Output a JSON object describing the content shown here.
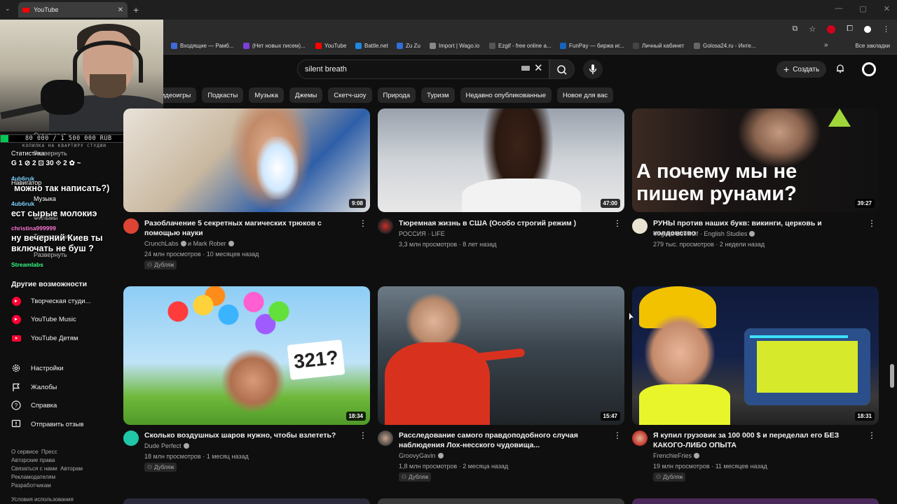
{
  "browser": {
    "tab_title": "YouTube",
    "bookmarks": [
      "Входящие — Рамб...",
      "(Нет новых писем)...",
      "YouTube",
      "Battle.net",
      "Zu Zu",
      "Import | Wago.io",
      "Ezgif - free online a...",
      "FunPay — биржа иг...",
      "Личный кабинет",
      "Golosa24.ru - Инте..."
    ],
    "all_bookmarks": "Все закладки"
  },
  "header": {
    "search_value": "silent breath",
    "create_label": "Создать"
  },
  "chips": [
    "идеоигры",
    "Подкасты",
    "Музыка",
    "Джемы",
    "Скетч-шоу",
    "Природа",
    "Туризм",
    "Недавно опубликованные",
    "Новое для вас"
  ],
  "sidebar": {
    "dim_items": [
      "Скачанные",
      "Развернуть",
      "Фильмы",
      "Трансляции",
      "Развернуть"
    ],
    "section_other": "Другие возможности",
    "other_items": [
      "Творческая студи...",
      "YouTube Music",
      "YouTube Детям"
    ],
    "settings_items": [
      "Настройки",
      "Жалобы",
      "Справка",
      "Отправить отзыв"
    ],
    "links": [
      "О сервисе",
      "Пресс",
      "Авторские права",
      "Связаться с нами",
      "Авторам",
      "Рекламодателям",
      "Разработчикам"
    ],
    "terms": "Условия использования"
  },
  "overlay": {
    "goal": "80 000 / 1 500 000 RUB",
    "goal_progress": 0.053,
    "goal_sub": "КОПИЛКА НА КВАРТИРУ СТУДИИ",
    "stats": "G 1  ⊘ 2  ⊡ 30  ⟐ 2  ✿ ~",
    "label_stats": "Статистика",
    "label_nav": "Навигатор",
    "label_music": "Музыка",
    "chat": [
      {
        "user": "4ub6ruk",
        "color": "#7fd1ff",
        "msg": "можно так написать?)"
      },
      {
        "user": "4ub6ruk",
        "color": "#7fd1ff",
        "msg": "ест сырые молокиэ"
      },
      {
        "user": "christina999999",
        "color": "#ff7ad9",
        "msg": "ну вечерний Киев ты включать не буш ?"
      },
      {
        "user": "Streamlabs",
        "color": "#3cff8a",
        "msg": ""
      }
    ]
  },
  "videos": [
    {
      "title": "Разоблачение 5 секретных магических трюков с помощью науки",
      "channel": "CrunchLabs",
      "channel2": "и Mark Rober",
      "meta": "24 млн просмотров · 10 месяцев назад",
      "badge": "Дубляж",
      "duration": "9:08"
    },
    {
      "title": "Тюремная жизнь в США (Особо строгий режим )",
      "channel": "РОССИЯ · LIFE",
      "channel2": "",
      "meta": "3,3 млн просмотров · 8 лет назад",
      "badge": "",
      "duration": "47:00"
    },
    {
      "title": "РУНЫ против наших букв: викинги, церковь и колдовство",
      "channel": "Virginia Bēowulf · English Studies",
      "channel2": "",
      "meta": "279 тыс. просмотров · 2 недели назад",
      "badge": "",
      "duration": "39:27",
      "thumb_text": "А почему мы не пишем рунами?"
    },
    {
      "title": "Сколько воздушных шаров нужно, чтобы взлететь?",
      "channel": "Dude Perfect",
      "channel2": "",
      "meta": "18 млн просмотров · 1 месяц назад",
      "badge": "Дубляж",
      "duration": "18:34",
      "thumb_text": "321?"
    },
    {
      "title": "Расследование самого правдоподобного случая наблюдения Лох-несского чудовища...",
      "channel": "GroovyGavin",
      "channel2": "",
      "meta": "1,8 млн просмотров · 2 месяца назад",
      "badge": "Дубляж",
      "duration": "15:47"
    },
    {
      "title": "Я купил грузовик за 100 000 $ и переделал его БЕЗ КАКОГО-ЛИБО ОПЫТА",
      "channel": "FrenchieFries",
      "channel2": "",
      "meta": "19 млн просмотров · 11 месяцев назад",
      "badge": "Дубляж",
      "duration": "18:31"
    }
  ],
  "colors": {
    "accent": "#ff0033",
    "bg": "#0f0f0f"
  }
}
